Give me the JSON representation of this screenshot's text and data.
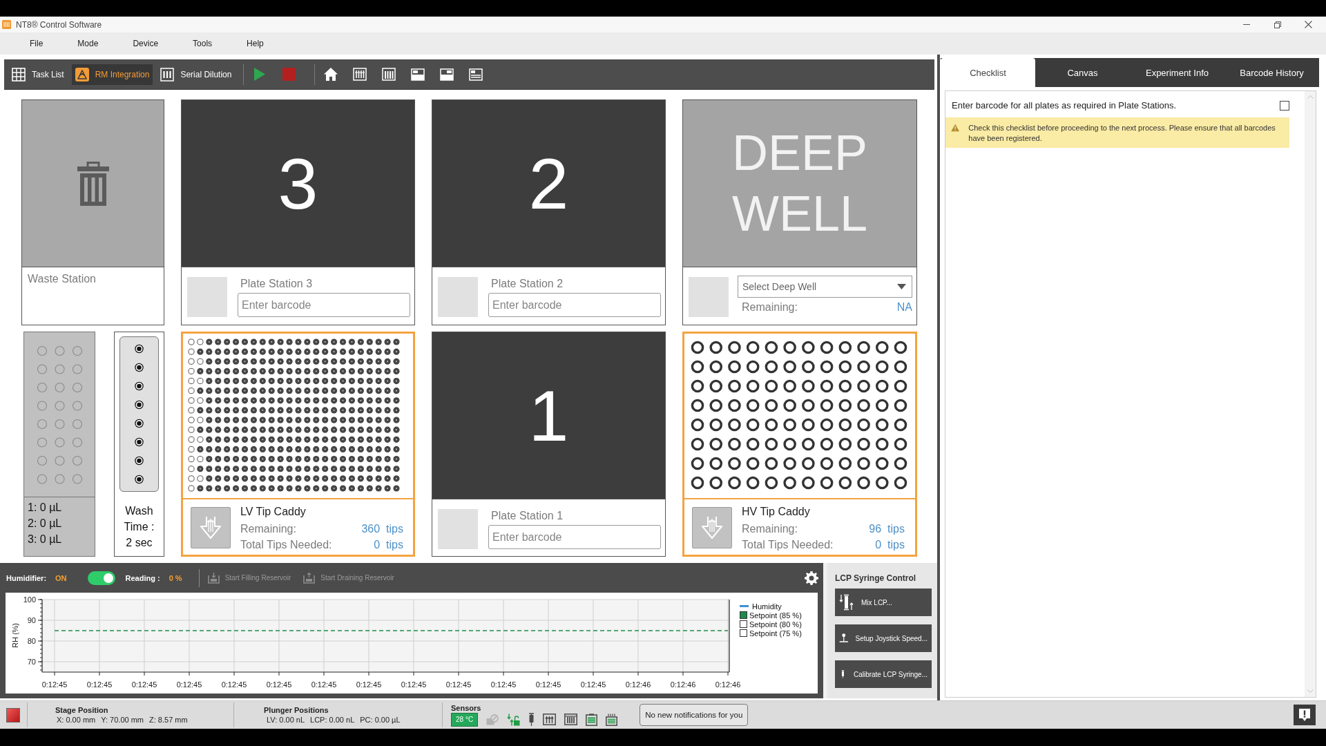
{
  "window": {
    "title": "NT8® Control Software"
  },
  "menu": [
    "File",
    "Mode",
    "Device",
    "Tools",
    "Help"
  ],
  "toolbar": {
    "modes": [
      {
        "label": "Task List",
        "selected": false
      },
      {
        "label": "RM Integration",
        "selected": true
      },
      {
        "label": "Serial Dilution",
        "selected": false
      }
    ]
  },
  "stations": {
    "waste": {
      "label": "Waste Station"
    },
    "plates": [
      {
        "number": "3",
        "label": "Plate Station 3",
        "barcode": {
          "placeholder": "Enter barcode"
        }
      },
      {
        "number": "2",
        "label": "Plate Station 2",
        "barcode": {
          "placeholder": "Enter barcode"
        }
      },
      {
        "number": "1",
        "label": "Plate Station 1",
        "barcode": {
          "placeholder": "Enter barcode"
        }
      }
    ],
    "deep_well": {
      "title": "DEEP WELL",
      "dropdown": {
        "placeholder": "Select Deep Well"
      },
      "remaining_label": "Remaining:",
      "remaining_value": "NA"
    },
    "reservoir": {
      "readings": [
        "1: 0 µL",
        "2: 0 µL",
        "3: 0 µL"
      ]
    },
    "wash": {
      "lines": [
        "Wash",
        "Time :",
        "2 sec"
      ]
    },
    "tip_caddies": [
      {
        "kind": "lv",
        "name": "LV Tip Caddy",
        "remaining_label": "Remaining:",
        "remaining": "360",
        "remaining_unit": "tips",
        "needed_label": "Total Tips Needed:",
        "needed": "0",
        "needed_unit": "tips",
        "tips": [
          [
            false,
            false,
            true,
            true,
            true,
            true,
            true,
            true,
            true,
            true,
            true,
            true,
            true,
            true,
            true,
            true,
            true,
            true,
            true,
            true,
            true,
            true,
            true,
            true
          ],
          [
            false,
            true,
            true,
            true,
            true,
            true,
            true,
            true,
            true,
            true,
            true,
            true,
            true,
            true,
            true,
            true,
            true,
            true,
            true,
            true,
            true,
            true,
            true,
            true
          ],
          [
            false,
            false,
            true,
            true,
            true,
            true,
            true,
            true,
            true,
            true,
            true,
            true,
            true,
            true,
            true,
            true,
            true,
            true,
            true,
            true,
            true,
            true,
            true,
            true
          ],
          [
            false,
            true,
            true,
            true,
            true,
            true,
            true,
            true,
            true,
            true,
            true,
            true,
            true,
            true,
            true,
            true,
            true,
            true,
            true,
            true,
            true,
            true,
            true,
            true
          ],
          [
            false,
            false,
            true,
            true,
            true,
            true,
            true,
            true,
            true,
            true,
            true,
            true,
            true,
            true,
            true,
            true,
            true,
            true,
            true,
            true,
            true,
            true,
            true,
            true
          ],
          [
            false,
            true,
            true,
            true,
            true,
            true,
            true,
            true,
            true,
            true,
            true,
            true,
            true,
            true,
            true,
            true,
            true,
            true,
            true,
            true,
            true,
            true,
            true,
            true
          ],
          [
            false,
            false,
            true,
            true,
            true,
            true,
            true,
            true,
            true,
            true,
            true,
            true,
            true,
            true,
            true,
            true,
            true,
            true,
            true,
            true,
            true,
            true,
            true,
            true
          ],
          [
            false,
            true,
            true,
            true,
            true,
            true,
            true,
            true,
            true,
            true,
            true,
            true,
            true,
            true,
            true,
            true,
            true,
            true,
            true,
            true,
            true,
            true,
            true,
            true
          ],
          [
            false,
            false,
            true,
            true,
            true,
            true,
            true,
            true,
            true,
            true,
            true,
            true,
            true,
            true,
            true,
            true,
            true,
            true,
            true,
            true,
            true,
            true,
            true,
            true
          ],
          [
            false,
            true,
            true,
            true,
            true,
            true,
            true,
            true,
            true,
            true,
            true,
            true,
            true,
            true,
            true,
            true,
            true,
            true,
            true,
            true,
            true,
            true,
            true,
            true
          ],
          [
            false,
            false,
            true,
            true,
            true,
            true,
            true,
            true,
            true,
            true,
            true,
            true,
            true,
            true,
            true,
            true,
            true,
            true,
            true,
            true,
            true,
            true,
            true,
            true
          ],
          [
            false,
            true,
            true,
            true,
            true,
            true,
            true,
            true,
            true,
            true,
            true,
            true,
            true,
            true,
            true,
            true,
            true,
            true,
            true,
            true,
            true,
            true,
            true,
            true
          ],
          [
            false,
            false,
            true,
            true,
            true,
            true,
            true,
            true,
            true,
            true,
            true,
            true,
            true,
            true,
            true,
            true,
            true,
            true,
            true,
            true,
            true,
            true,
            true,
            true
          ],
          [
            false,
            true,
            true,
            true,
            true,
            true,
            true,
            true,
            true,
            true,
            true,
            true,
            true,
            true,
            true,
            true,
            true,
            true,
            true,
            true,
            true,
            true,
            true,
            true
          ],
          [
            false,
            false,
            true,
            true,
            true,
            true,
            true,
            true,
            true,
            true,
            true,
            true,
            true,
            true,
            true,
            true,
            true,
            true,
            true,
            true,
            true,
            true,
            true,
            true
          ],
          [
            false,
            true,
            true,
            true,
            true,
            true,
            true,
            true,
            true,
            true,
            true,
            true,
            true,
            true,
            true,
            true,
            true,
            true,
            true,
            true,
            true,
            true,
            true,
            true
          ]
        ]
      },
      {
        "kind": "hv",
        "name": "HV Tip Caddy",
        "remaining_label": "Remaining:",
        "remaining": "96",
        "remaining_unit": "tips",
        "needed_label": "Total Tips Needed:",
        "needed": "0",
        "needed_unit": "tips",
        "tips": [
          [
            true,
            true,
            true,
            true,
            true,
            true,
            true,
            true,
            true,
            true,
            true,
            true
          ],
          [
            true,
            true,
            true,
            true,
            true,
            true,
            true,
            true,
            true,
            true,
            true,
            true
          ],
          [
            true,
            true,
            true,
            true,
            true,
            true,
            true,
            true,
            true,
            true,
            true,
            true
          ],
          [
            true,
            true,
            true,
            true,
            true,
            true,
            true,
            true,
            true,
            true,
            true,
            true
          ],
          [
            true,
            true,
            true,
            true,
            true,
            true,
            true,
            true,
            true,
            true,
            true,
            true
          ],
          [
            true,
            true,
            true,
            true,
            true,
            true,
            true,
            true,
            true,
            true,
            true,
            true
          ],
          [
            true,
            true,
            true,
            true,
            true,
            true,
            true,
            true,
            true,
            true,
            true,
            true
          ],
          [
            true,
            true,
            true,
            true,
            true,
            true,
            true,
            true,
            true,
            true,
            true,
            true
          ]
        ]
      }
    ]
  },
  "humidifier": {
    "label": "Humidifier:",
    "status": "ON",
    "on": true,
    "reading_label": "Reading :",
    "reading": "0 %",
    "actions": [
      {
        "label": "Start Filling Reservoir",
        "disabled": true
      },
      {
        "label": "Start Draining Reservoir",
        "disabled": true
      }
    ],
    "chart_data": {
      "type": "line",
      "ylabel": "RH (%)",
      "grid": true,
      "categories": [
        "0:12:45",
        "0:12:45",
        "0:12:45",
        "0:12:45",
        "0:12:45",
        "0:12:45",
        "0:12:45",
        "0:12:45",
        "0:12:45",
        "0:12:45",
        "0:12:45",
        "0:12:45",
        "0:12:45",
        "0:12:46",
        "0:12:46",
        "0:12:46"
      ],
      "ylim": [
        65,
        100
      ],
      "yticks": [
        70,
        80,
        90,
        100
      ],
      "series": [
        {
          "name": "Humidity",
          "color": "#3b8fd6",
          "values": [
            null,
            null,
            null,
            null,
            null,
            null,
            null,
            null,
            null,
            null,
            null,
            null,
            null,
            null,
            null,
            null
          ]
        },
        {
          "name": "Setpoint (85 %)",
          "color": "#1f8a4c",
          "line_style": "dashed",
          "values": [
            85,
            85,
            85,
            85,
            85,
            85,
            85,
            85,
            85,
            85,
            85,
            85,
            85,
            85,
            85,
            85
          ]
        },
        {
          "name": "Setpoint (80 %)",
          "values": [
            null,
            null,
            null,
            null,
            null,
            null,
            null,
            null,
            null,
            null,
            null,
            null,
            null,
            null,
            null,
            null
          ]
        },
        {
          "name": "Setpoint (75 %)",
          "values": [
            null,
            null,
            null,
            null,
            null,
            null,
            null,
            null,
            null,
            null,
            null,
            null,
            null,
            null,
            null,
            null
          ]
        }
      ]
    },
    "legend_checks": [
      {
        "checked": true
      },
      {
        "checked": false
      },
      {
        "checked": false
      }
    ]
  },
  "lcp_syringe_control": {
    "title": "LCP Syringe Control",
    "buttons": [
      "Mix LCP...",
      "Setup Joystick Speed...",
      "Calibrate LCP Syringe..."
    ]
  },
  "right_panel": {
    "tabs": [
      {
        "label": "Checklist",
        "selected": true
      },
      {
        "label": "Canvas",
        "selected": false
      },
      {
        "label": "Experiment Info",
        "selected": false
      },
      {
        "label": "Barcode History",
        "selected": false
      }
    ],
    "checklist": [
      {
        "text": "Enter barcode for all plates as required in Plate Stations.",
        "checked": false
      }
    ],
    "warning": "Check this checklist before proceeding to the next process. Please ensure that all barcodes have been registered."
  },
  "status_bar": {
    "stage": {
      "title": "Stage Position",
      "values": [
        "X: 0.00 mm",
        "Y: 70.00 mm",
        "Z: 8.57 mm"
      ]
    },
    "plunger": {
      "title": "Plunger Positions",
      "values": [
        "LV: 0.00 nL",
        "LCP: 0.00 nL",
        "PC: 0.00 µL"
      ]
    },
    "sensors": {
      "title": "Sensors",
      "temperature": "28 °C",
      "icons": [
        {
          "active": false
        },
        {
          "active": true
        },
        {
          "active": false
        },
        {
          "active": false
        },
        {
          "active": false
        },
        {
          "active": true
        },
        {
          "active": true
        }
      ]
    },
    "notification": "No new notifications for you"
  }
}
